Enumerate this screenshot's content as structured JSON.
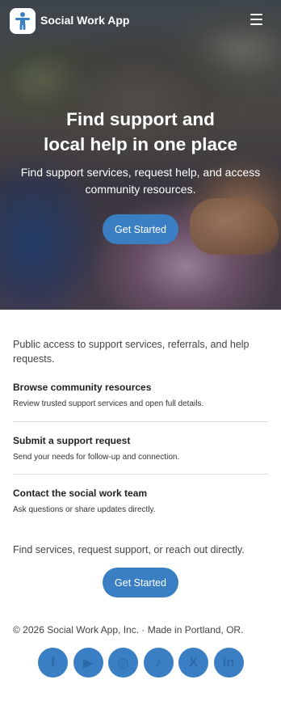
{
  "header": {
    "app_name": "Social Work App",
    "logo_icon": "accessibility-person-icon",
    "menu_icon": "hamburger-menu-icon"
  },
  "hero": {
    "title_line1": "Find support and",
    "title_line2": "local help in one place",
    "subtitle": "Find support services, request help, and access community resources.",
    "cta_label": "Get Started"
  },
  "main": {
    "intro": "Public access to support services, referrals, and help requests.",
    "items": [
      {
        "title": "Browse community resources",
        "description": "Review trusted support services and open full details."
      },
      {
        "title": "Submit a support request",
        "description": "Send your needs for follow-up and connection."
      },
      {
        "title": "Contact the social work team",
        "description": "Ask questions or share updates directly."
      }
    ],
    "cta_text": "Find services, request support, or reach out directly.",
    "cta_label": "Get Started"
  },
  "footer": {
    "copyright": "© 2026 Social Work App, Inc. · Made in Portland, OR.",
    "socials": [
      {
        "name": "facebook-icon",
        "glyph": "f"
      },
      {
        "name": "youtube-icon",
        "glyph": "▶"
      },
      {
        "name": "instagram-icon",
        "glyph": "◎"
      },
      {
        "name": "tiktok-icon",
        "glyph": "♪"
      },
      {
        "name": "x-icon",
        "glyph": "X"
      },
      {
        "name": "linkedin-icon",
        "glyph": "in"
      }
    ]
  },
  "colors": {
    "accent": "#3a7fc4",
    "social_glyph": "#2b6aa8",
    "text": "#444444"
  }
}
